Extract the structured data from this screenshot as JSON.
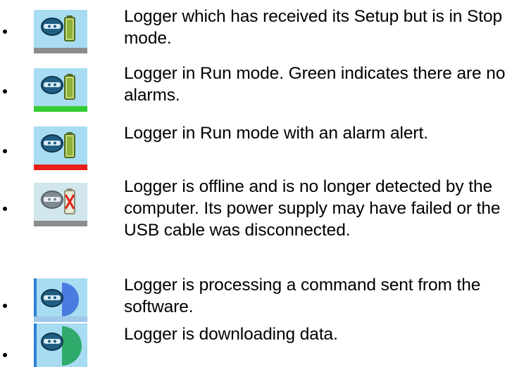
{
  "items": [
    {
      "icon": "logger-stopped-icon",
      "state": "stopped",
      "text": "Logger which has received its Setup but is in Stop mode.",
      "bar_color": "#8c8c8c"
    },
    {
      "icon": "logger-running-icon",
      "state": "running",
      "text": "Logger in Run mode. Green indicates there are no alarms.",
      "bar_color": "#33cc33"
    },
    {
      "icon": "logger-alarm-icon",
      "state": "alarm",
      "text": "Logger in Run mode with an alarm alert.",
      "bar_color": "#e8201a"
    },
    {
      "icon": "logger-offline-icon",
      "state": "offline",
      "text": "Logger is offline and is no longer detected by the computer. Its power supply may have failed or the USB cable was disconnected.",
      "bar_color": "#8c8c8c"
    },
    {
      "icon": "logger-processing-icon",
      "state": "processing",
      "text": "Logger is processing a command sent from the software.",
      "bar_color": "#4a7be0"
    },
    {
      "icon": "logger-downloading-icon",
      "state": "downloading",
      "text": "Logger is downloading data.",
      "bar_color": "#2faa6a"
    }
  ]
}
